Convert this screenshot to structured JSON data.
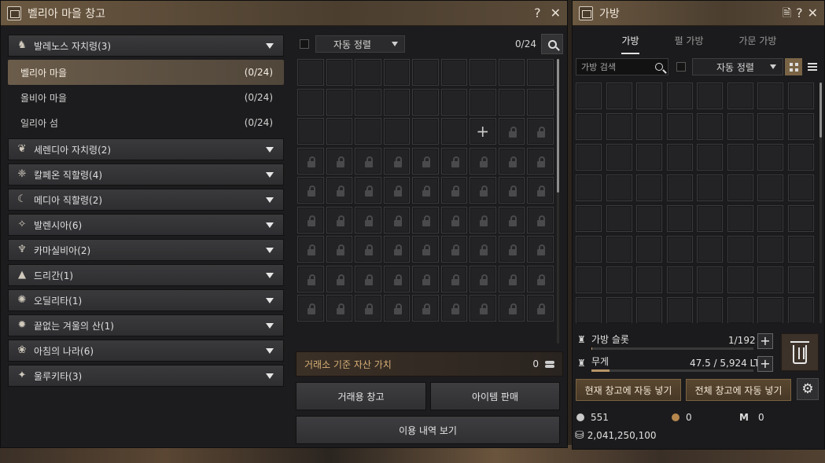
{
  "storage": {
    "title": "벨리아 마을 창고",
    "help": "?",
    "close": "✕",
    "regions": [
      {
        "name": "발레노스 자치령(3)",
        "icon": "horse-icon",
        "glyph": "♞",
        "expanded": true,
        "subs": [
          {
            "name": "벨리아 마을",
            "count": "(0/24)",
            "active": true
          },
          {
            "name": "올비아 마을",
            "count": "(0/24)",
            "active": false
          },
          {
            "name": "일리아 섬",
            "count": "(0/24)",
            "active": false
          }
        ]
      },
      {
        "name": "세렌디아 자치령(2)",
        "icon": "feather-icon",
        "glyph": "❦"
      },
      {
        "name": "칼페온 직할령(4)",
        "icon": "wings-icon",
        "glyph": "❈"
      },
      {
        "name": "메디아 직할령(2)",
        "icon": "moon-icon",
        "glyph": "☾"
      },
      {
        "name": "발렌시아(6)",
        "icon": "sun-emblem-icon",
        "glyph": "✧"
      },
      {
        "name": "카마실비아(2)",
        "icon": "tree-icon",
        "glyph": "♆"
      },
      {
        "name": "드리간(1)",
        "icon": "mountain-icon",
        "glyph": "▲"
      },
      {
        "name": "오딜리타(1)",
        "icon": "star-emblem-icon",
        "glyph": "✺"
      },
      {
        "name": "끝없는 겨울의 산(1)",
        "icon": "snowflake-icon",
        "glyph": "✹"
      },
      {
        "name": "아침의 나라(6)",
        "icon": "flower-icon",
        "glyph": "❀"
      },
      {
        "name": "울루키타(3)",
        "icon": "compass-icon",
        "glyph": "✦"
      }
    ],
    "sort_label": "자동 정렬",
    "slot_count": "0/24",
    "asset_label": "거래소 기준 자산 가치",
    "asset_value": "0",
    "trade_storage": "거래용 창고",
    "item_sell": "아이템 판매",
    "usage_history": "이용 내역 보기",
    "open_slots": 24,
    "plus_slot_index": 24,
    "total_slots": 81
  },
  "inventory": {
    "title": "가방",
    "tabs": [
      "가방",
      "펄 가방",
      "가문 가방"
    ],
    "active_tab": 0,
    "search_placeholder": "가방 검색",
    "sort_label": "자동 정렬",
    "slot_label": "가방 슬롯",
    "slot_value": "1/192",
    "weight_label": "무게",
    "weight_value": "47.5 / 5,924 LT",
    "weight_fraction": 0.008,
    "slot_fraction": 0.005,
    "auto_store_current": "현재 창고에 자동 넣기",
    "auto_store_all": "전체 창고에 자동 넣기",
    "energy_points": "551",
    "contribution": "0",
    "might": "0",
    "silver": "2,041,250,100",
    "accent": "#b89466"
  }
}
